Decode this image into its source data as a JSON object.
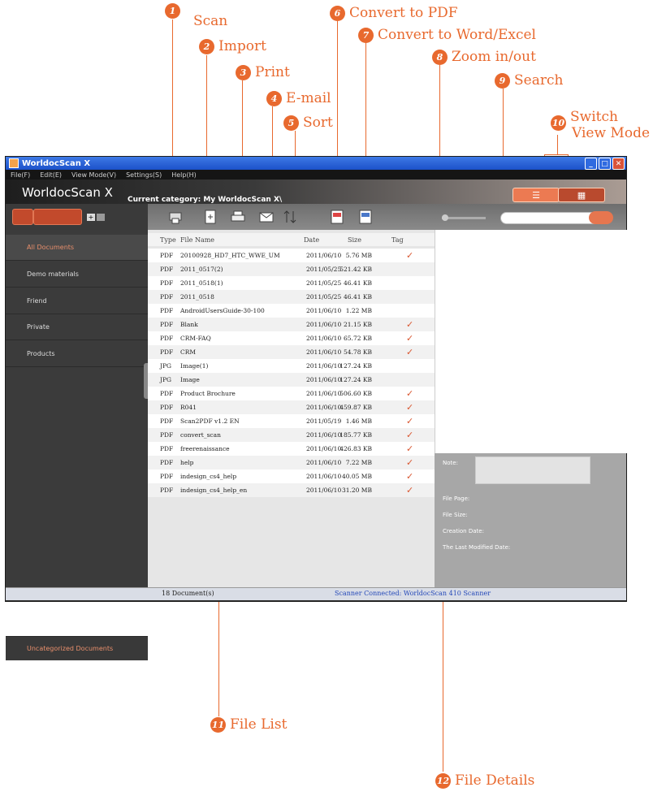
{
  "callouts": {
    "scan": {
      "n": "1",
      "label": "Scan"
    },
    "import": {
      "n": "2",
      "label": "Import"
    },
    "print": {
      "n": "3",
      "label": "Print"
    },
    "email": {
      "n": "4",
      "label": "E-mail"
    },
    "sort": {
      "n": "5",
      "label": "Sort"
    },
    "convert_pdf": {
      "n": "6",
      "label": "Convert to PDF"
    },
    "convert_word": {
      "n": "7",
      "label": "Convert to Word/Excel"
    },
    "zoom": {
      "n": "8",
      "label": "Zoom in/out"
    },
    "search": {
      "n": "9",
      "label": "Search"
    },
    "switch": {
      "n": "10",
      "line1": "Switch",
      "line2": "View Mode"
    },
    "file_list": {
      "n": "11",
      "label": "File List"
    },
    "file_details": {
      "n": "12",
      "label": "File Details"
    }
  },
  "window": {
    "title": "WorldocScan X",
    "menu": [
      "File(F)",
      "Edit(E)",
      "View Mode(V)",
      "Settings(S)",
      "Help(H)"
    ],
    "brand": "WorldocScan X",
    "current_category": "Current category: My WorldocScan X\\",
    "view_mode_list_icon": "list-icon",
    "view_mode_grid_icon": "grid-icon",
    "buttons": {
      "minimize": "_",
      "maximize": "□",
      "close": "✕"
    }
  },
  "sidebar": {
    "items": [
      "All Documents",
      "Demo materials",
      "Friend",
      "Private",
      "Products"
    ],
    "selected": 0,
    "uncategorized": "Uncategorized Documents"
  },
  "file_list": {
    "headers": {
      "type": "Type",
      "name": "File Name",
      "date": "Date",
      "size": "Size",
      "tag": "Tag"
    },
    "rows": [
      {
        "type": "PDF",
        "name": "20100928_HD7_HTC_WWE_UM",
        "date": "2011/06/10",
        "size": "5.76 MB",
        "tag": true
      },
      {
        "type": "PDF",
        "name": "2011_0517(2)",
        "date": "2011/05/25",
        "size": "521.42 KB",
        "tag": false
      },
      {
        "type": "PDF",
        "name": "2011_0518(1)",
        "date": "2011/05/25",
        "size": "46.41 KB",
        "tag": false
      },
      {
        "type": "PDF",
        "name": "2011_0518",
        "date": "2011/05/25",
        "size": "46.41 KB",
        "tag": false
      },
      {
        "type": "PDF",
        "name": "AndroidUsersGuide-30-100",
        "date": "2011/06/10",
        "size": "1.22 MB",
        "tag": false
      },
      {
        "type": "PDF",
        "name": "Blank",
        "date": "2011/06/10",
        "size": "21.15 KB",
        "tag": true
      },
      {
        "type": "PDF",
        "name": "CRM-FAQ",
        "date": "2011/06/10",
        "size": "65.72 KB",
        "tag": true
      },
      {
        "type": "PDF",
        "name": "CRM",
        "date": "2011/06/10",
        "size": "54.78 KB",
        "tag": true
      },
      {
        "type": "JPG",
        "name": "Image(1)",
        "date": "2011/06/10",
        "size": "127.24 KB",
        "tag": false
      },
      {
        "type": "JPG",
        "name": "Image",
        "date": "2011/06/10",
        "size": "127.24 KB",
        "tag": false
      },
      {
        "type": "PDF",
        "name": "Product Brochure",
        "date": "2011/06/10",
        "size": "506.60 KB",
        "tag": true
      },
      {
        "type": "PDF",
        "name": "R041",
        "date": "2011/06/10",
        "size": "459.87 KB",
        "tag": true
      },
      {
        "type": "PDF",
        "name": "Scan2PDF v1.2 EN",
        "date": "2011/05/19",
        "size": "1.46 MB",
        "tag": true
      },
      {
        "type": "PDF",
        "name": "convert_scan",
        "date": "2011/06/10",
        "size": "185.77 KB",
        "tag": true
      },
      {
        "type": "PDF",
        "name": "freerenaissance",
        "date": "2011/06/10",
        "size": "426.83 KB",
        "tag": true
      },
      {
        "type": "PDF",
        "name": "help",
        "date": "2011/06/10",
        "size": "7.22 MB",
        "tag": true
      },
      {
        "type": "PDF",
        "name": "indesign_cs4_help",
        "date": "2011/06/10",
        "size": "40.05 MB",
        "tag": true
      },
      {
        "type": "PDF",
        "name": "indesign_cs4_help_en",
        "date": "2011/06/10",
        "size": "31.20 MB",
        "tag": true
      }
    ],
    "tag_mark": "✓"
  },
  "details": {
    "note": "Note:",
    "file_page": "File Page:",
    "file_size": "File Size:",
    "creation_date": "Creation Date:",
    "modified_date": "The Last Modified Date:"
  },
  "status": {
    "count": "18 Document(s)",
    "scanner": "Scanner Connected:  WorldocScan 410 Scanner"
  },
  "colors": {
    "accent": "#e8692e"
  }
}
